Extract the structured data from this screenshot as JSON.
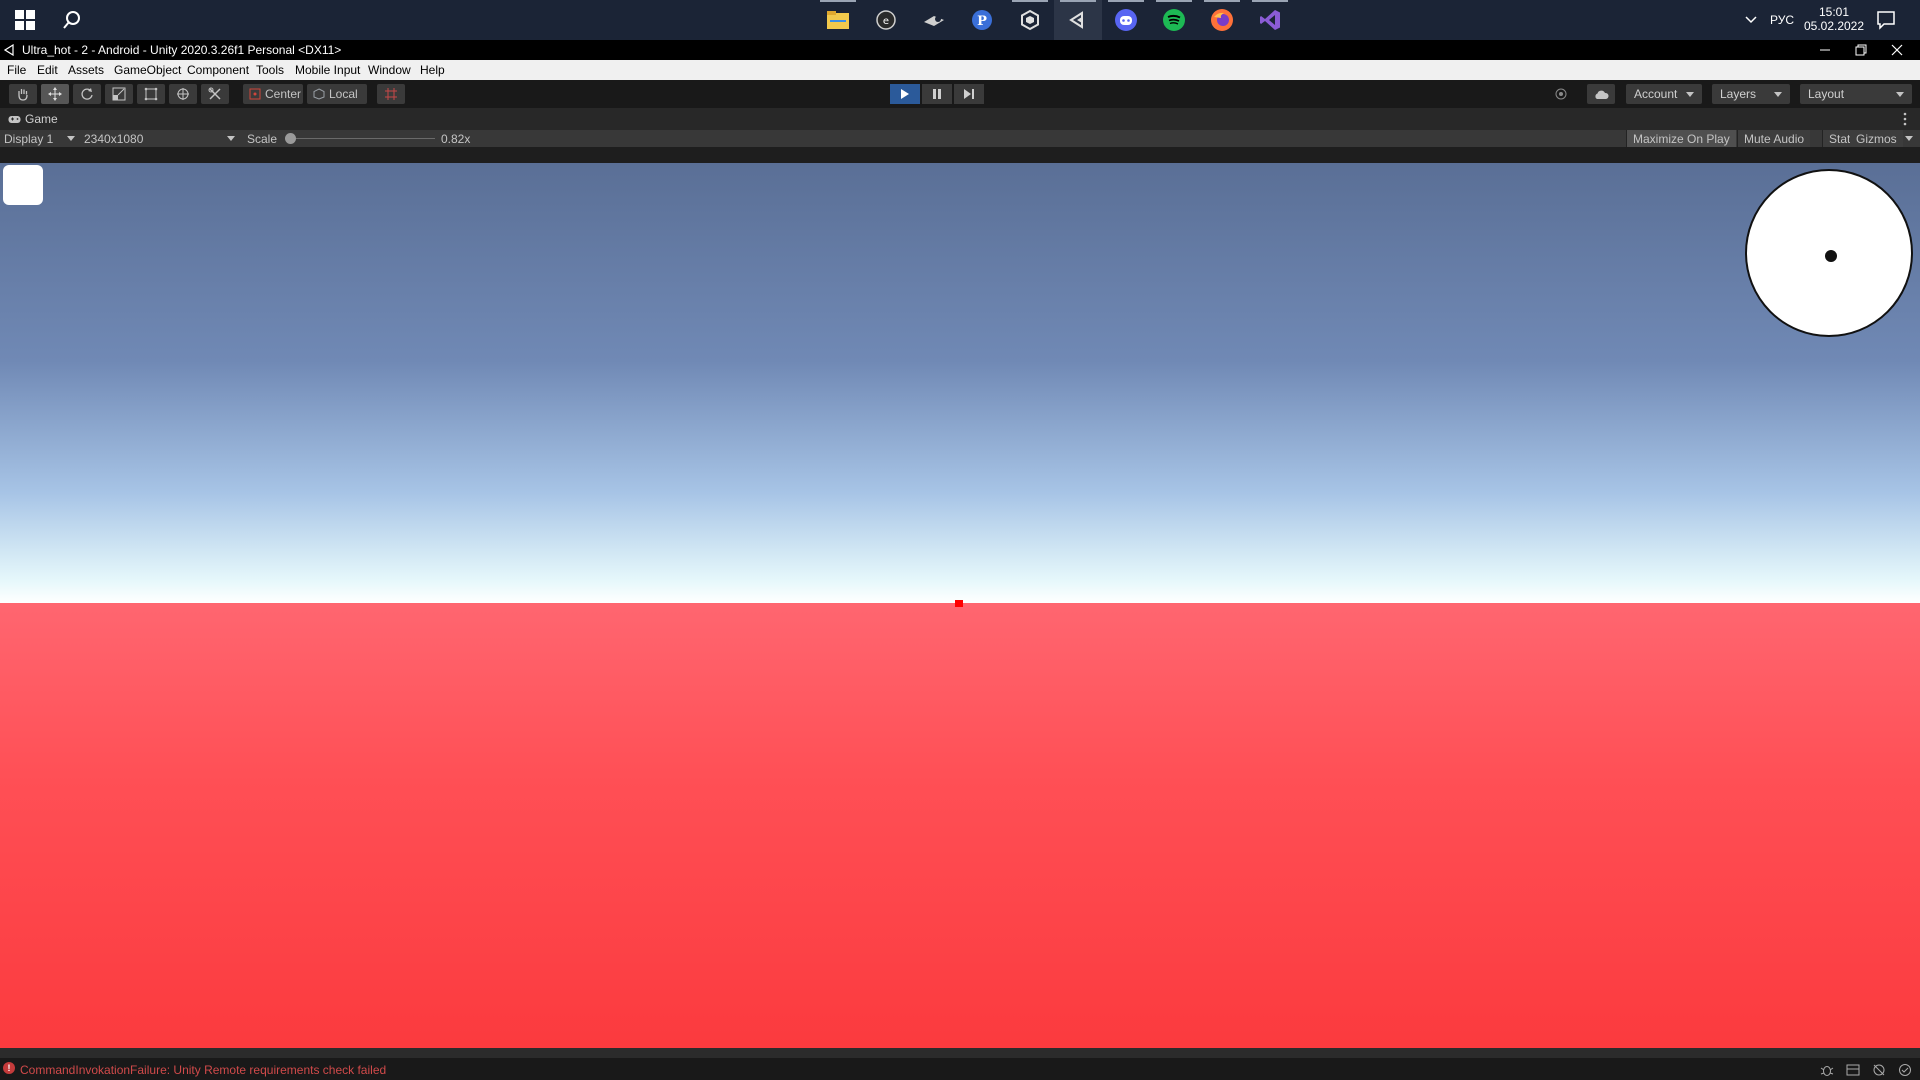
{
  "taskbar": {
    "apps": [
      {
        "name": "file-explorer",
        "color": "#f2c94c"
      },
      {
        "name": "app-circle",
        "color": "#cfcfcf"
      },
      {
        "name": "steam",
        "color": "#cfcfcf"
      },
      {
        "name": "p-app",
        "color": "#3a6fd8"
      },
      {
        "name": "unity-hub",
        "color": "#e0e0e0"
      },
      {
        "name": "unity-editor",
        "color": "#e0e0e0"
      },
      {
        "name": "discord",
        "color": "#5865f2"
      },
      {
        "name": "spotify",
        "color": "#1db954"
      },
      {
        "name": "firefox",
        "color": "#ff7139"
      },
      {
        "name": "visual-studio",
        "color": "#8b5cd6"
      }
    ],
    "language": "РУС",
    "time": "15:01",
    "date": "05.02.2022"
  },
  "window": {
    "title": "Ultra_hot - 2 - Android - Unity 2020.3.26f1 Personal <DX11>"
  },
  "menu": [
    "File",
    "Edit",
    "Assets",
    "GameObject",
    "Component",
    "Tools",
    "Mobile Input",
    "Window",
    "Help"
  ],
  "toolbar": {
    "pivot_label": "Center",
    "space_label": "Local",
    "account_label": "Account",
    "layers_label": "Layers",
    "layout_label": "Layout"
  },
  "game": {
    "tab_label": "Game",
    "display_label": "Display 1",
    "resolution_label": "2340x1080",
    "scale_label": "Scale",
    "scale_value": "0.82x",
    "maximize_label": "Maximize On Play",
    "mute_label": "Mute Audio",
    "stats_label": "Stats",
    "gizmos_label": "Gizmos"
  },
  "status": {
    "message": "CommandInvokationFailure: Unity Remote requirements check failed"
  },
  "colors": {
    "sky_top": "#5a6f96",
    "horizon": "#e6f8fb",
    "ground": "#ff4f55",
    "crosshair": "#ff0000",
    "play_active": "#2b5a9a"
  }
}
